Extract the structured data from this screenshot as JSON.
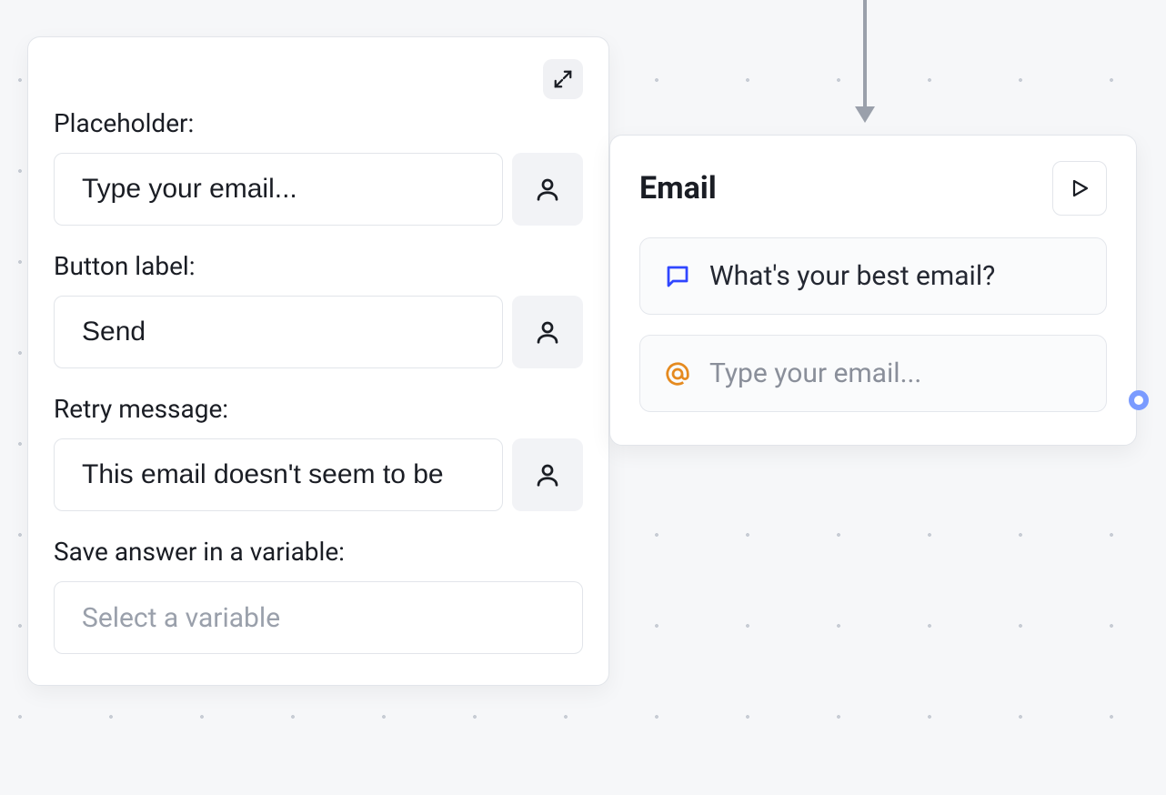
{
  "panel": {
    "placeholder_label": "Placeholder:",
    "placeholder_value": "Type your email...",
    "button_label_label": "Button label:",
    "button_label_value": "Send",
    "retry_label": "Retry message:",
    "retry_value": "This email doesn't seem to be",
    "variable_label": "Save answer in a variable:",
    "variable_placeholder": "Select a variable"
  },
  "node": {
    "title": "Email",
    "prompt": "What's your best email?",
    "input_placeholder": "Type your email..."
  },
  "icons": {
    "expand": "expand-icon",
    "person": "person-icon",
    "play": "play-icon",
    "chat": "chat-icon",
    "at": "at-icon"
  }
}
